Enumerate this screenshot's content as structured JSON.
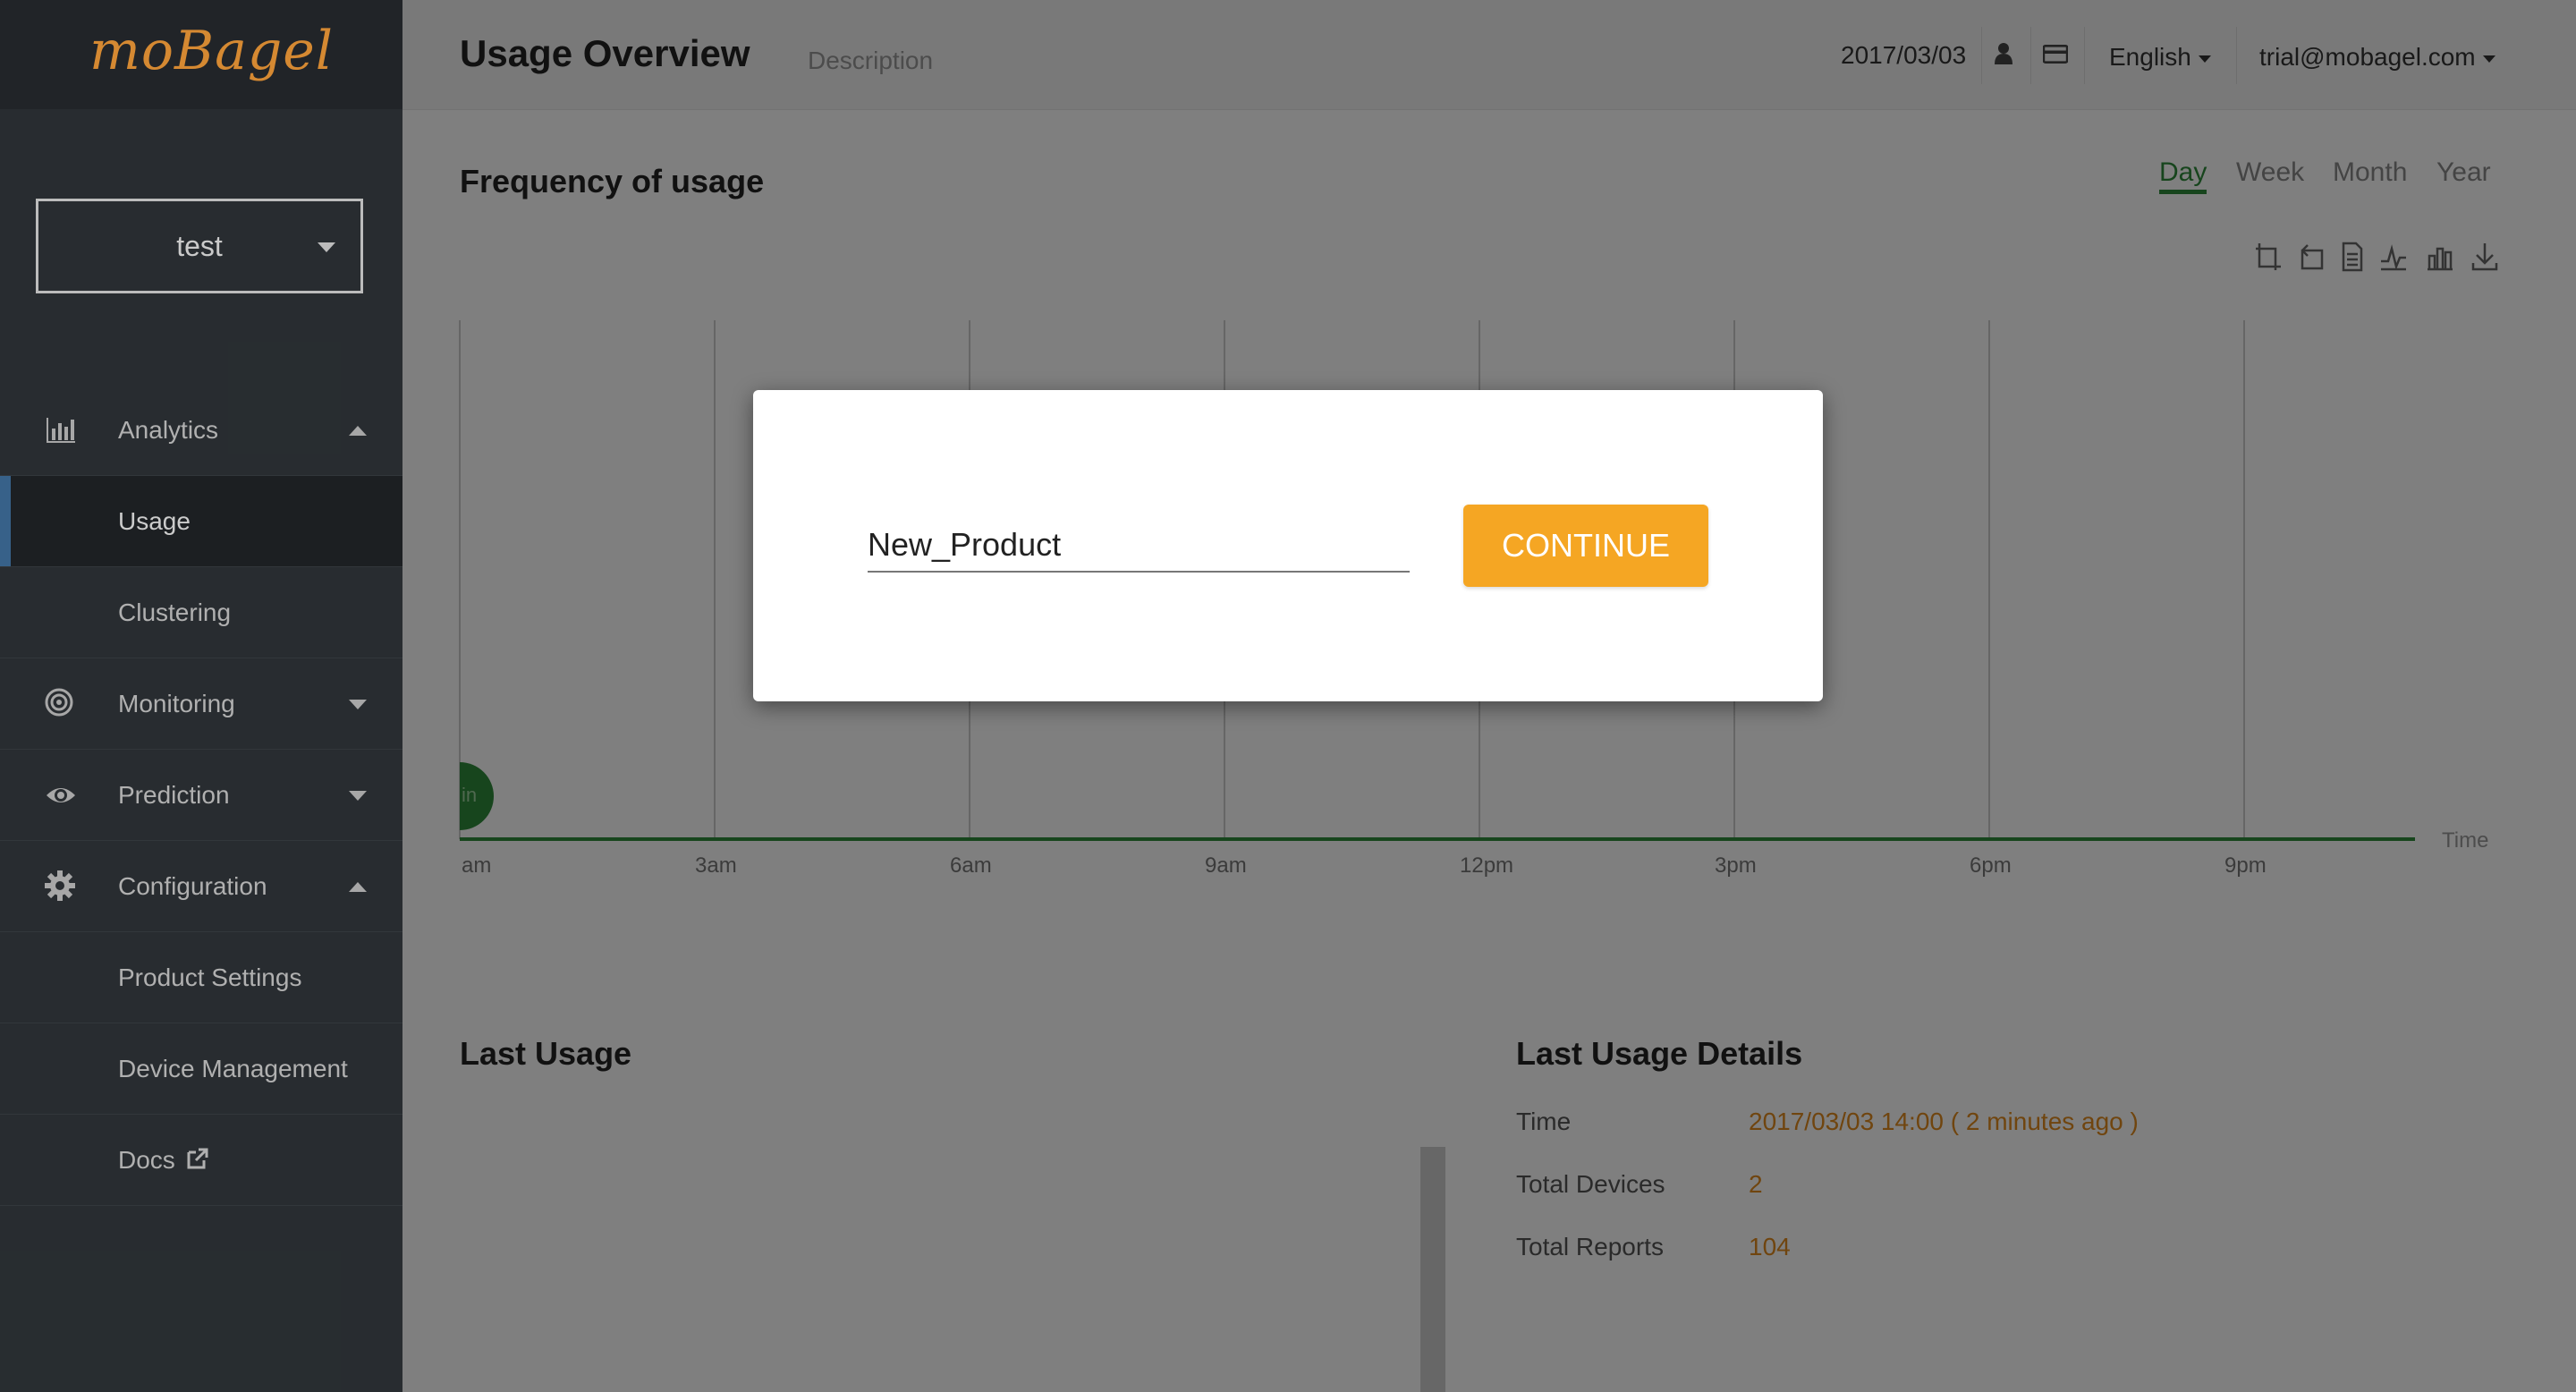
{
  "app": {
    "logo": "moBagel"
  },
  "sidebar": {
    "product_select": "test",
    "items": [
      {
        "label": "Analytics",
        "icon": "bar-chart-icon",
        "expanded": true
      },
      {
        "label": "Usage",
        "active": true
      },
      {
        "label": "Clustering"
      },
      {
        "label": "Monitoring",
        "icon": "target-icon",
        "expanded": false
      },
      {
        "label": "Prediction",
        "icon": "eye-icon",
        "expanded": false
      },
      {
        "label": "Configuration",
        "icon": "gear-icon",
        "expanded": true
      },
      {
        "label": "Product Settings"
      },
      {
        "label": "Device Management"
      },
      {
        "label": "Docs",
        "icon": "external-link-icon"
      }
    ]
  },
  "header": {
    "title": "Usage Overview",
    "description": "Description",
    "date": "2017/03/03",
    "language": "English",
    "email": "trial@mobagel.com"
  },
  "frequency": {
    "title": "Frequency of usage",
    "periods": [
      "Day",
      "Week",
      "Month",
      "Year"
    ],
    "active_period": "Day",
    "toolbox_icons": [
      "zoom-icon",
      "zoom-reset-icon",
      "data-view-icon",
      "line-chart-icon",
      "bar-chart-icon",
      "download-icon"
    ]
  },
  "chart_data": {
    "type": "line",
    "x_ticks": [
      "am",
      "3am",
      "6am",
      "9am",
      "12pm",
      "3pm",
      "6pm",
      "9pm"
    ],
    "xlabel": "Time",
    "marker_label": "in",
    "colors": {
      "axis": "#2f8a3b",
      "grid": "#cccccc"
    }
  },
  "last_usage": {
    "title": "Last Usage",
    "details_title": "Last Usage Details",
    "rows": [
      {
        "label": "Time",
        "value": "2017/03/03 14:00 ( 2 minutes ago )"
      },
      {
        "label": "Total Devices",
        "value": "2"
      },
      {
        "label": "Total Reports",
        "value": "104"
      }
    ]
  },
  "modal": {
    "input_value": "New_Product",
    "button_label": "CONTINUE",
    "button_color": "#f5a623"
  }
}
